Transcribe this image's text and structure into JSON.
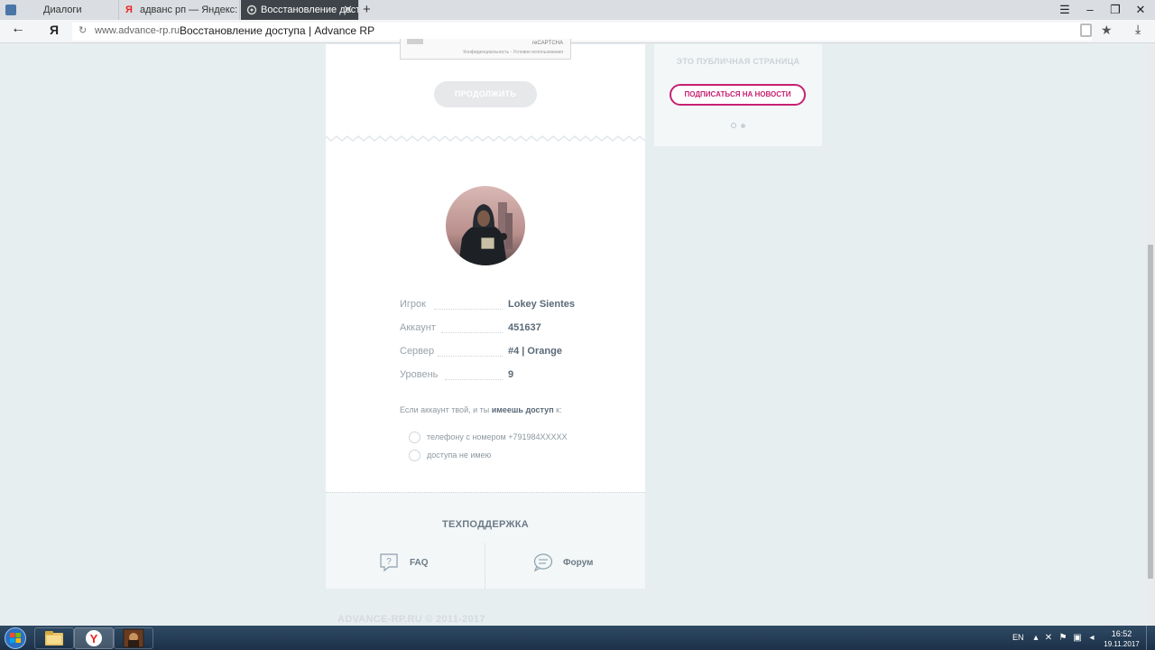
{
  "browser": {
    "tabs": [
      {
        "title": "Диалоги",
        "active": false
      },
      {
        "title": "адванс рп — Яндекс: нашлось",
        "active": false
      },
      {
        "title": "Восстановление доступа",
        "active": true
      }
    ],
    "url_host": "www.advance-rp.ru",
    "url_title": "Восстановление доступа | Advance RP",
    "logo": "Я"
  },
  "recaptcha": {
    "label": "reCAPTCHA",
    "terms": "Конфиденциальность - Условия использования"
  },
  "main": {
    "continue_label": "ПРОДОЛЖИТЬ",
    "player": [
      {
        "label": "Игрок",
        "value": "Lokey Sientes"
      },
      {
        "label": "Аккаунт",
        "value": "451637"
      },
      {
        "label": "Сервер",
        "value": "#4 | Orange"
      },
      {
        "label": "Уровень",
        "value": "9"
      }
    ],
    "access_prefix": "Если аккаунт твой, и ты ",
    "access_bold": "имеешь доступ",
    "access_suffix": " к:",
    "options": [
      {
        "label": "телефону с номером +791984XXXXX"
      },
      {
        "label": "доступа не имею"
      }
    ]
  },
  "support": {
    "title": "ТЕХПОДДЕРЖКА",
    "faq_label": "FAQ",
    "forum_label": "Форум"
  },
  "sidebar": {
    "public_text": "ЭТО ПУБЛИЧНАЯ СТРАНИЦА",
    "subscribe_label": "ПОДПИСАТЬСЯ НА НОВОСТИ"
  },
  "footer": {
    "copyright": "ADVANCE-RP.RU © 2011-2017"
  },
  "taskbar": {
    "lang": "EN",
    "time": "16:52",
    "date": "19.11.2017"
  },
  "colors": {
    "accent": "#c62271",
    "page_bg": "#e7eef0",
    "text_label": "#97a2ab",
    "text_value": "#5a6a78"
  }
}
